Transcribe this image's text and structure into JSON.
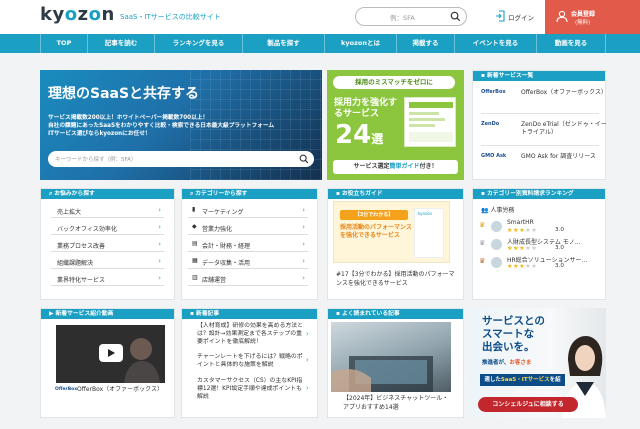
{
  "header": {
    "logo": "kyozon",
    "tagline": "SaaS・ITサービスの比較サイト",
    "search_placeholder": "例：SFA",
    "login_label": "ログイン",
    "register_line1": "会員登録",
    "register_line2": "(無料)"
  },
  "nav": {
    "items": [
      "TOP",
      "記事を読む",
      "ランキングを見る",
      "製品を探す",
      "kyozonとは",
      "掲載する",
      "イベントを見る",
      "動画を見る"
    ]
  },
  "hero": {
    "title": "理想のSaaSと共存する",
    "desc1": "サービス掲載数200以上！ホワイトペーパー掲載数700以上！",
    "desc2": "自社の課題にあったSaaSをわかりやすく比較・検索できる日本最大級プラットフォーム",
    "desc3": "ITサービス選びならkyozonにお任せ！",
    "search_placeholder": "キーワードから探す（例：SFA）"
  },
  "green_banner": {
    "tag": "採用のミスマッチをゼロに",
    "title": "採用力を強化するサービス",
    "number": "24",
    "unit": "選",
    "foot_a": "サービス選定",
    "foot_b": "簡単ガイド",
    "foot_c": "付き！"
  },
  "new_services": {
    "header": "新着サービス一覧",
    "items": [
      {
        "logo": "OfferBox",
        "name": "OfferBox（オファーボックス）"
      },
      {
        "logo": "ZenDo",
        "name": "ZenDo eTrial（ゼンドゥ・イートライアル）"
      },
      {
        "logo": "GMO Ask",
        "name": "GMO Ask for 調査リリース"
      }
    ]
  },
  "worries": {
    "header": "お悩みから探す",
    "items": [
      "売上拡大",
      "バックオフィス効率化",
      "業務プロセス改善",
      "組織課題解決",
      "業界特化サービス"
    ]
  },
  "categories": {
    "header": "カテゴリーから探す",
    "items": [
      "マーケティング",
      "営業力強化",
      "会計・財務・経理",
      "データ収集・活用",
      "店舗運営"
    ]
  },
  "guide": {
    "header": "お役立ちガイド",
    "badge": "【3分でわかる】",
    "image_text": "採用活動のパフォーマンスを強化できるサービス",
    "brand": "kyozon",
    "caption": "#17【3分でわかる】採用活動のパフォーマンスを強化できるサービス"
  },
  "ranking": {
    "header": "カテゴリー別資料請求ランキング",
    "category": "人事労務",
    "items": [
      {
        "name": "SmartHR",
        "stars": 3,
        "rating": "3.0"
      },
      {
        "name": "人財成長型システム モノ…",
        "stars": 3,
        "rating": "3.0"
      },
      {
        "name": "HR総合ソリューションサー…",
        "stars": 3,
        "rating": "3.0"
      }
    ]
  },
  "video_panel": {
    "header": "新着サービス紹介動画",
    "logo": "OfferBox",
    "name": "OfferBox（オファーボックス）"
  },
  "news": {
    "header": "新着記事",
    "items": [
      "【人材育成】研修の効果を高める方法とは？設計→効果測定まで各ステップの重要ポイントを徹底解説！",
      "チャーンレートを下げるには？戦略のポイントと具体的な施策を解説",
      "カスタマーサクセス（CS）の主なKPI指標12選！KPI設定手順や達成ポイントも解説"
    ]
  },
  "popular": {
    "header": "よく読まれている記事",
    "caption": "【2024年】ビジネスチャットツール・アプリおすすめ14選"
  },
  "ad": {
    "headline1": "サービスとの",
    "headline2": "スマートな",
    "headline3": "出会いを。",
    "line1_a": "推進者が、",
    "line1_b": "お客さま",
    "line1_c": "各del課題に",
    "line2_a": "適した",
    "line2_b": "SaaS・ITサービス",
    "line2_c": "を紹介！",
    "cta": "コンシェルジュに相談する"
  },
  "colors": {
    "primary": "#1ba0c3",
    "accent": "#e25a49",
    "green": "#8cc63f",
    "navy": "#0c4c87"
  }
}
